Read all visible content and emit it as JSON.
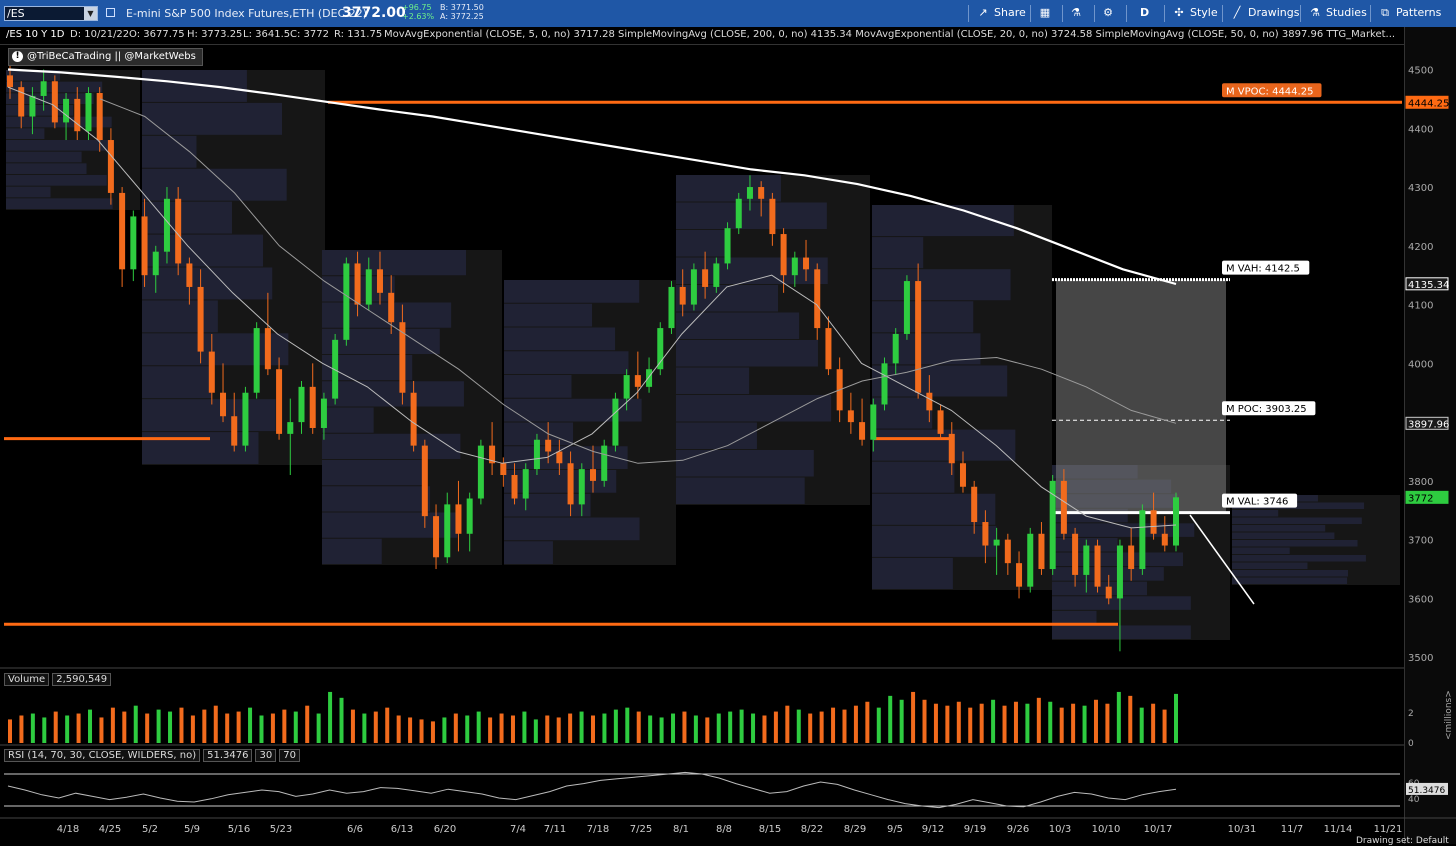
{
  "toolbar": {
    "symbol": "/ES",
    "description": "E-mini S&P 500 Index Futures,ETH (DEC 22)",
    "price": "3772.00",
    "change": "+96.75",
    "change_pct": "+2.63%",
    "bid": "B: 3771.50",
    "ask": "A: 3772.25",
    "share": "Share",
    "period": "D",
    "style": "Style",
    "drawings": "Drawings",
    "studies": "Studies",
    "patterns": "Patterns"
  },
  "infobar": {
    "symbol_tf": "/ES 10 Y 1D",
    "date": "D: 10/21/22",
    "open": "O: 3677.75",
    "high": "H: 3773.25",
    "low": "L: 3641.5",
    "close": "C: 3772",
    "range": "R: 131.75",
    "studies": "MovAvgExponential (CLOSE, 5, 0, no) 3717.28  SimpleMovingAvg (CLOSE, 200, 0, no) 4135.34  MovAvgExponential (CLOSE, 20, 0, no) 3724.58  SimpleMovingAvg (CLOSE, 50, 0, no) 3897.96  TTG_Market..."
  },
  "watermark": "@TriBeCaTrading || @MarketWebs",
  "watermark_icon": "info-icon",
  "volume_pane": {
    "label": "Volume",
    "value": "2,590,549",
    "axis_unit": "<millions>",
    "axis_ticks": [
      "2",
      "0"
    ]
  },
  "rsi_pane": {
    "label": "RSI (14, 70, 30, CLOSE, WILDERS, no)",
    "value": "51.3476",
    "lower": "30",
    "upper": "70",
    "axis_ticks": [
      "60",
      "40"
    ],
    "last_value_tag": "51.3476"
  },
  "footer_text": "Drawing set: Default",
  "colors": {
    "up": "#2ecc40",
    "down": "#f26b1d",
    "accent_orange": "#ff6a13",
    "toolbar": "#1f57a6",
    "value_area": "#808080"
  },
  "chart_data": {
    "type": "candlestick",
    "ylim": [
      3485,
      4540
    ],
    "y_ticks": [
      4500,
      4400,
      4300,
      4200,
      4100,
      4000,
      3900,
      3800,
      3700,
      3600,
      3500
    ],
    "x_ticks": [
      "4/18",
      "4/25",
      "5/2",
      "5/9",
      "5/16",
      "5/23",
      "6/6",
      "6/13",
      "6/20",
      "7/4",
      "7/11",
      "7/18",
      "7/25",
      "8/1",
      "8/8",
      "8/15",
      "8/22",
      "8/29",
      "9/5",
      "9/12",
      "9/19",
      "9/26",
      "10/3",
      "10/10",
      "10/17",
      "10/31",
      "11/7",
      "11/14",
      "11/21"
    ],
    "price_tags": [
      {
        "text": "4444.25",
        "value": 4444.25,
        "color": "#ff6a13"
      },
      {
        "text": "4135.34",
        "value": 4135.34,
        "color": "#ffffff"
      },
      {
        "text": "3897.96",
        "value": 3897.96,
        "color": "#cccccc"
      },
      {
        "text": "3772",
        "value": 3772,
        "color": "#2ecc40"
      }
    ],
    "annotations": [
      {
        "text": "M VPOC: 4444.25",
        "value": 4444.25
      },
      {
        "text": "M VAH: 4142.5",
        "value": 4142.5
      },
      {
        "text": "M POC: 3903.25",
        "value": 3903.25
      },
      {
        "text": "M VAL: 3746",
        "value": 3746
      }
    ],
    "horizontal_levels": [
      4444.25,
      3872,
      3556
    ],
    "series_ohlc": [
      [
        4490,
        4510,
        4450,
        4470
      ],
      [
        4470,
        4480,
        4400,
        4420
      ],
      [
        4420,
        4470,
        4390,
        4455
      ],
      [
        4455,
        4500,
        4430,
        4480
      ],
      [
        4480,
        4490,
        4400,
        4410
      ],
      [
        4410,
        4460,
        4380,
        4450
      ],
      [
        4450,
        4470,
        4380,
        4395
      ],
      [
        4395,
        4470,
        4380,
        4460
      ],
      [
        4460,
        4470,
        4360,
        4380
      ],
      [
        4380,
        4400,
        4270,
        4290
      ],
      [
        4290,
        4300,
        4130,
        4160
      ],
      [
        4160,
        4260,
        4140,
        4250
      ],
      [
        4250,
        4280,
        4130,
        4150
      ],
      [
        4150,
        4200,
        4120,
        4190
      ],
      [
        4190,
        4300,
        4170,
        4280
      ],
      [
        4280,
        4300,
        4150,
        4170
      ],
      [
        4170,
        4180,
        4100,
        4130
      ],
      [
        4130,
        4160,
        4000,
        4020
      ],
      [
        4020,
        4050,
        3930,
        3950
      ],
      [
        3950,
        4000,
        3900,
        3910
      ],
      [
        3910,
        3950,
        3850,
        3860
      ],
      [
        3860,
        3960,
        3850,
        3950
      ],
      [
        3950,
        4070,
        3940,
        4060
      ],
      [
        4060,
        4120,
        3980,
        3990
      ],
      [
        3990,
        4010,
        3870,
        3880
      ],
      [
        3880,
        3940,
        3810,
        3900
      ],
      [
        3900,
        3970,
        3880,
        3960
      ],
      [
        3960,
        4000,
        3880,
        3890
      ],
      [
        3890,
        3950,
        3870,
        3940
      ],
      [
        3940,
        4050,
        3930,
        4040
      ],
      [
        4040,
        4180,
        4030,
        4170
      ],
      [
        4170,
        4190,
        4080,
        4100
      ],
      [
        4100,
        4180,
        4090,
        4160
      ],
      [
        4160,
        4190,
        4100,
        4120
      ],
      [
        4120,
        4150,
        4050,
        4070
      ],
      [
        4070,
        4100,
        3930,
        3950
      ],
      [
        3950,
        3970,
        3850,
        3860
      ],
      [
        3860,
        3870,
        3720,
        3740
      ],
      [
        3740,
        3760,
        3650,
        3670
      ],
      [
        3670,
        3780,
        3660,
        3760
      ],
      [
        3760,
        3800,
        3680,
        3710
      ],
      [
        3710,
        3780,
        3680,
        3770
      ],
      [
        3770,
        3870,
        3760,
        3860
      ],
      [
        3860,
        3900,
        3810,
        3830
      ],
      [
        3830,
        3840,
        3790,
        3810
      ],
      [
        3810,
        3830,
        3760,
        3770
      ],
      [
        3770,
        3830,
        3750,
        3820
      ],
      [
        3820,
        3880,
        3810,
        3870
      ],
      [
        3870,
        3900,
        3830,
        3850
      ],
      [
        3850,
        3870,
        3810,
        3830
      ],
      [
        3830,
        3850,
        3740,
        3760
      ],
      [
        3760,
        3830,
        3740,
        3820
      ],
      [
        3820,
        3860,
        3780,
        3800
      ],
      [
        3800,
        3870,
        3790,
        3860
      ],
      [
        3860,
        3950,
        3850,
        3940
      ],
      [
        3940,
        3990,
        3920,
        3980
      ],
      [
        3980,
        4020,
        3940,
        3960
      ],
      [
        3960,
        4010,
        3950,
        3990
      ],
      [
        3990,
        4070,
        3980,
        4060
      ],
      [
        4060,
        4140,
        4050,
        4130
      ],
      [
        4130,
        4160,
        4080,
        4100
      ],
      [
        4100,
        4170,
        4090,
        4160
      ],
      [
        4160,
        4190,
        4110,
        4130
      ],
      [
        4130,
        4180,
        4120,
        4170
      ],
      [
        4170,
        4240,
        4160,
        4230
      ],
      [
        4230,
        4290,
        4220,
        4280
      ],
      [
        4280,
        4320,
        4260,
        4300
      ],
      [
        4300,
        4310,
        4250,
        4280
      ],
      [
        4280,
        4290,
        4200,
        4220
      ],
      [
        4220,
        4230,
        4120,
        4150
      ],
      [
        4150,
        4190,
        4130,
        4180
      ],
      [
        4180,
        4210,
        4140,
        4160
      ],
      [
        4160,
        4170,
        4040,
        4060
      ],
      [
        4060,
        4080,
        3980,
        3990
      ],
      [
        3990,
        4010,
        3900,
        3920
      ],
      [
        3920,
        3950,
        3880,
        3900
      ],
      [
        3900,
        3940,
        3860,
        3870
      ],
      [
        3870,
        3940,
        3850,
        3930
      ],
      [
        3930,
        4010,
        3920,
        4000
      ],
      [
        4000,
        4060,
        3980,
        4050
      ],
      [
        4050,
        4150,
        4040,
        4140
      ],
      [
        4140,
        4170,
        3940,
        3950
      ],
      [
        3950,
        3980,
        3900,
        3920
      ],
      [
        3920,
        3930,
        3870,
        3880
      ],
      [
        3880,
        3900,
        3810,
        3830
      ],
      [
        3830,
        3850,
        3780,
        3790
      ],
      [
        3790,
        3800,
        3710,
        3730
      ],
      [
        3730,
        3750,
        3660,
        3690
      ],
      [
        3690,
        3720,
        3640,
        3700
      ],
      [
        3700,
        3710,
        3640,
        3660
      ],
      [
        3660,
        3680,
        3600,
        3620
      ],
      [
        3620,
        3720,
        3610,
        3710
      ],
      [
        3710,
        3730,
        3640,
        3650
      ],
      [
        3650,
        3810,
        3640,
        3800
      ],
      [
        3800,
        3820,
        3700,
        3710
      ],
      [
        3710,
        3720,
        3620,
        3640
      ],
      [
        3640,
        3700,
        3610,
        3690
      ],
      [
        3690,
        3700,
        3610,
        3620
      ],
      [
        3620,
        3640,
        3590,
        3600
      ],
      [
        3600,
        3700,
        3510,
        3690
      ],
      [
        3690,
        3720,
        3630,
        3650
      ],
      [
        3650,
        3760,
        3640,
        3750
      ],
      [
        3750,
        3780,
        3700,
        3710
      ],
      [
        3710,
        3740,
        3680,
        3690
      ],
      [
        3690,
        3780,
        3680,
        3772
      ]
    ],
    "sma200": [
      4500,
      4495,
      4488,
      4480,
      4470,
      4458,
      4445,
      4432,
      4420,
      4405,
      4390,
      4375,
      4360,
      4345,
      4330,
      4320,
      4305,
      4285,
      4260,
      4230,
      4195,
      4160,
      4135
    ],
    "ema20": [
      4470,
      4440,
      4380,
      4290,
      4200,
      4120,
      4050,
      4000,
      3960,
      3900,
      3850,
      3830,
      3840,
      3880,
      3950,
      4050,
      4130,
      4150,
      4100,
      4000,
      3960,
      3920,
      3860,
      3790,
      3740,
      3720,
      3725
    ],
    "sma50": [
      4450,
      4420,
      4360,
      4290,
      4200,
      4140,
      4090,
      4040,
      3990,
      3930,
      3880,
      3850,
      3830,
      3835,
      3860,
      3900,
      3940,
      3970,
      3985,
      4005,
      4010,
      3990,
      3960,
      3920,
      3898
    ],
    "volume": [
      1.2,
      1.4,
      1.5,
      1.3,
      1.6,
      1.4,
      1.5,
      1.7,
      1.3,
      1.8,
      1.6,
      1.9,
      1.5,
      1.7,
      1.6,
      1.8,
      1.4,
      1.7,
      1.9,
      1.5,
      1.6,
      1.8,
      1.4,
      1.5,
      1.7,
      1.6,
      1.9,
      1.5,
      2.6,
      2.3,
      1.7,
      1.5,
      1.6,
      1.8,
      1.4,
      1.3,
      1.2,
      1.1,
      1.3,
      1.5,
      1.4,
      1.6,
      1.3,
      1.5,
      1.4,
      1.6,
      1.2,
      1.4,
      1.3,
      1.5,
      1.6,
      1.4,
      1.5,
      1.7,
      1.8,
      1.6,
      1.4,
      1.3,
      1.5,
      1.6,
      1.4,
      1.3,
      1.5,
      1.6,
      1.7,
      1.5,
      1.4,
      1.6,
      1.9,
      1.7,
      1.5,
      1.6,
      1.8,
      1.7,
      1.9,
      2.1,
      1.8,
      2.4,
      2.2,
      2.6,
      2.2,
      2.0,
      1.9,
      2.1,
      1.8,
      2.0,
      2.2,
      1.9,
      2.1,
      2.0,
      2.3,
      2.1,
      1.8,
      2.0,
      1.9,
      2.2,
      2.0,
      2.6,
      2.4,
      1.8,
      2.0,
      1.7,
      2.5
    ],
    "rsi": [
      55,
      50,
      44,
      40,
      46,
      42,
      38,
      41,
      45,
      40,
      36,
      35,
      39,
      44,
      47,
      50,
      48,
      42,
      45,
      50,
      46,
      48,
      53,
      52,
      49,
      46,
      51,
      48,
      45,
      40,
      38,
      43,
      48,
      55,
      58,
      62,
      64,
      66,
      68,
      70,
      72,
      70,
      65,
      58,
      52,
      46,
      48,
      55,
      60,
      57,
      50,
      44,
      38,
      33,
      30,
      28,
      32,
      38,
      34,
      30,
      29,
      35,
      42,
      47,
      45,
      40,
      38,
      44,
      48,
      51
    ]
  }
}
